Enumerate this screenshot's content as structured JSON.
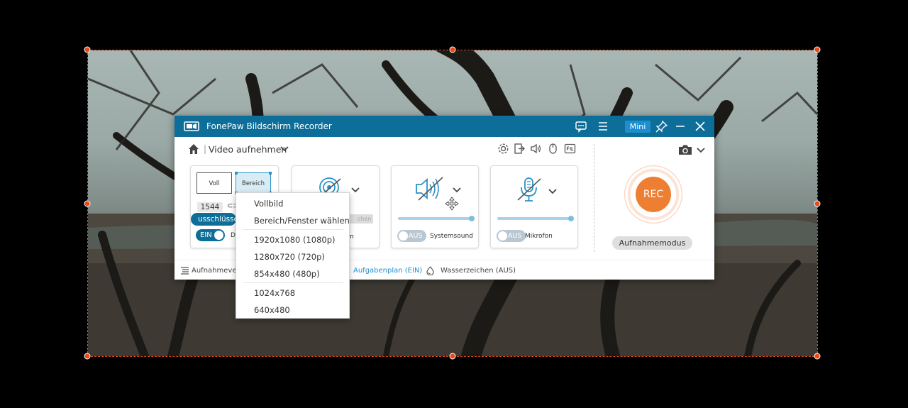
{
  "window": {
    "app_title": "FonePaw Bildschirm Recorder",
    "mini_label": "Mini",
    "mode_title": "Video aufnehmen"
  },
  "area": {
    "full_label": "Voll",
    "region_label": "Bereich",
    "width_value": "1544",
    "link_glyph": "⊂⊃",
    "exclude_label": "usschlüsse",
    "follow_toggle": "EIN",
    "follow_label": "D"
  },
  "webcam": {
    "bar_text": "chen",
    "label": "m"
  },
  "system_sound": {
    "toggle": "AUS",
    "label": "Systemsound"
  },
  "microphone": {
    "toggle": "AUS",
    "label": "Mikrofon"
  },
  "record": {
    "rec_label": "REC",
    "mode_label": "Aufnahmemodus"
  },
  "bottom": {
    "history_label": "Aufnahmeverla",
    "schedule_label": "Aufgabenplan (EIN)",
    "watermark_label": "Wasserzeichen (AUS)"
  },
  "dropdown": {
    "items": [
      "Vollbild",
      "Bereich/Fenster wählen",
      "1920x1080 (1080p)",
      "1280x720 (720p)",
      "854x480 (480p)",
      "1024x768",
      "640x480"
    ]
  },
  "colors": {
    "titlebar": "#0d6e9a",
    "accent": "#1d8fd0",
    "rec": "#ee7f32",
    "selection": "#e04a1c"
  }
}
